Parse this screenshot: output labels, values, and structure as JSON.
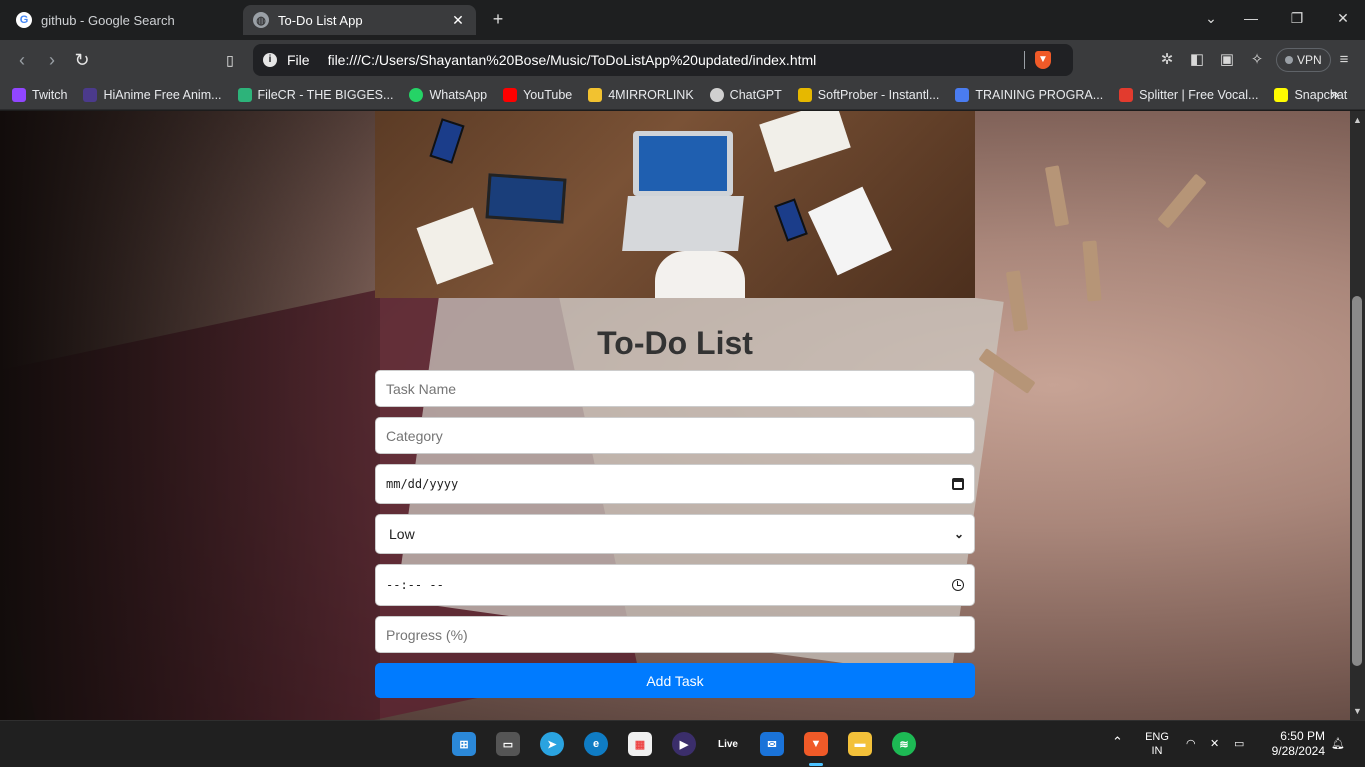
{
  "browser": {
    "tabs": [
      {
        "title": "github - Google Search",
        "favicon": "google-icon"
      },
      {
        "title": "To-Do List App",
        "favicon": "globe-icon",
        "active": true
      }
    ],
    "address": {
      "scheme_label": "File",
      "url": "file:///C:/Users/Shayantan%20Bose/Music/ToDoListApp%20updated/index.html"
    },
    "vpn_label": "VPN",
    "bookmarks": [
      {
        "label": "Twitch",
        "color": "#9146ff"
      },
      {
        "label": "HiAnime Free Anim...",
        "color": "#4b3a8c"
      },
      {
        "label": "FileCR - THE BIGGES...",
        "color": "#2db37a"
      },
      {
        "label": "WhatsApp",
        "color": "#25d366"
      },
      {
        "label": "YouTube",
        "color": "#ff0000"
      },
      {
        "label": "4MIRRORLINK",
        "color": "#f2c230"
      },
      {
        "label": "ChatGPT",
        "color": "#d0d0d0"
      },
      {
        "label": "SoftProber - Instantl...",
        "color": "#e6b800"
      },
      {
        "label": "TRAINING PROGRA...",
        "color": "#4a7cf0"
      },
      {
        "label": "Splitter | Free Vocal...",
        "color": "#e23b2e"
      },
      {
        "label": "Snapchat",
        "color": "#fffc00"
      }
    ]
  },
  "app": {
    "title": "To-Do List",
    "task_name_placeholder": "Task Name",
    "category_placeholder": "Category",
    "date_placeholder": "mm/dd/yyyy",
    "priority_selected": "Low",
    "time_placeholder": "--:-- --",
    "progress_placeholder": "Progress (%)",
    "add_button": "Add Task",
    "accent_color": "#007bff"
  },
  "taskbar": {
    "language": "ENG",
    "region": "IN",
    "time": "6:50 PM",
    "date": "9/28/2024",
    "live_label": "Live"
  }
}
